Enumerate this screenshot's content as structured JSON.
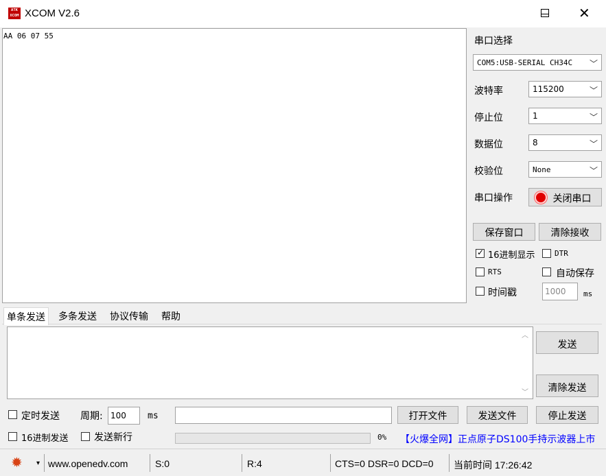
{
  "window": {
    "title": "XCOM V2.6",
    "icon_text": "ATK XCOM",
    "minimize": "—",
    "close": "✕"
  },
  "receive": {
    "text": "AA 06 07 55"
  },
  "settings": {
    "port_label": "串口选择",
    "port_value": "COM5:USB-SERIAL CH34C",
    "baud_label": "波特率",
    "baud_value": "115200",
    "stop_label": "停止位",
    "stop_value": "1",
    "data_label": "数据位",
    "data_value": "8",
    "parity_label": "校验位",
    "parity_value": "None",
    "op_label": "串口操作",
    "op_button": "关闭串口",
    "save_window": "保存窗口",
    "clear_receive": "清除接收",
    "hex_display": "16进制显示",
    "dtr": "DTR",
    "rts": "RTS",
    "auto_save": "自动保存",
    "timestamp": "时间戳",
    "timestamp_ms_value": "1000",
    "ms_unit": "ms"
  },
  "tabs": [
    {
      "label": "单条发送",
      "active": true
    },
    {
      "label": "多条发送",
      "active": false
    },
    {
      "label": "协议传输",
      "active": false
    },
    {
      "label": "帮助",
      "active": false
    }
  ],
  "send": {
    "send_button": "发送",
    "clear_send": "清除发送",
    "timed_send": "定时发送",
    "period_label": "周期:",
    "period_value": "100",
    "period_unit": "ms",
    "open_file": "打开文件",
    "send_file": "发送文件",
    "stop_send": "停止发送",
    "hex_send": "16进制发送",
    "send_newline": "发送新行",
    "progress_text": "0%",
    "progress": 0,
    "ad_text": "【火爆全网】正点原子DS100手持示波器上市"
  },
  "statusbar": {
    "gear_icon": "gear-icon",
    "dropdown": "▾",
    "website": "www.openedv.com",
    "sent": "S:0",
    "received": "R:4",
    "lines": "CTS=0 DSR=0 DCD=0",
    "time": "当前时间 17:26:42"
  },
  "colors": {
    "accent_red": "#e00000",
    "ad_blue": "#0000ff",
    "gear_orange": "#d84315"
  }
}
